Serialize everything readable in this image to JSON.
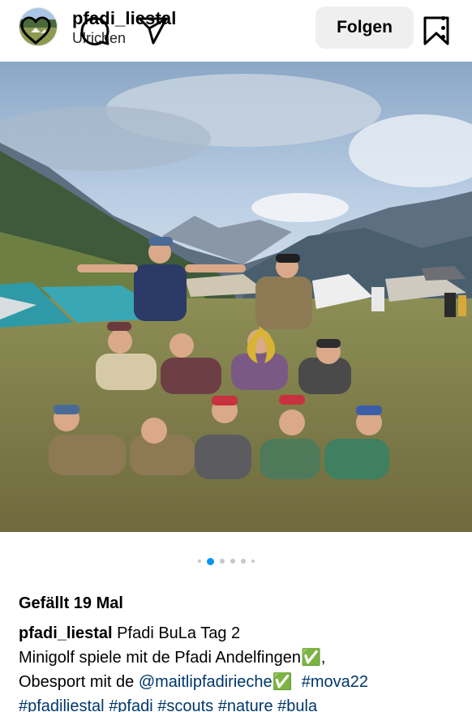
{
  "post": {
    "username": "pfadi_liestal",
    "location": "Ulrichen",
    "follow_label": "Folgen",
    "likes_text": "Gefällt 19 Mal",
    "carousel": {
      "count": 6,
      "active_index": 1
    },
    "caption": {
      "username": "pfadi_liestal",
      "title": "Pfadi BuLa Tag 2",
      "line1": "Minigolf spiele mit de Pfadi Andelfingen✅,",
      "line2_prefix": "Obesport mit de ",
      "mention": "@maitlipfadirieche",
      "line2_check": "✅",
      "tag_mova": "#mova22",
      "hashtags": [
        "#pfadiliestal",
        "#pfadi",
        "#scouts",
        "#nature",
        "#bula"
      ]
    }
  },
  "icons": {
    "more": "more-vertical-icon",
    "like": "heart-icon",
    "comment": "comment-icon",
    "share": "paper-plane-icon",
    "save": "bookmark-icon"
  },
  "colors": {
    "link": "#00376b",
    "carousel_active": "#0095f6",
    "follow_button_bg": "#efefef"
  }
}
